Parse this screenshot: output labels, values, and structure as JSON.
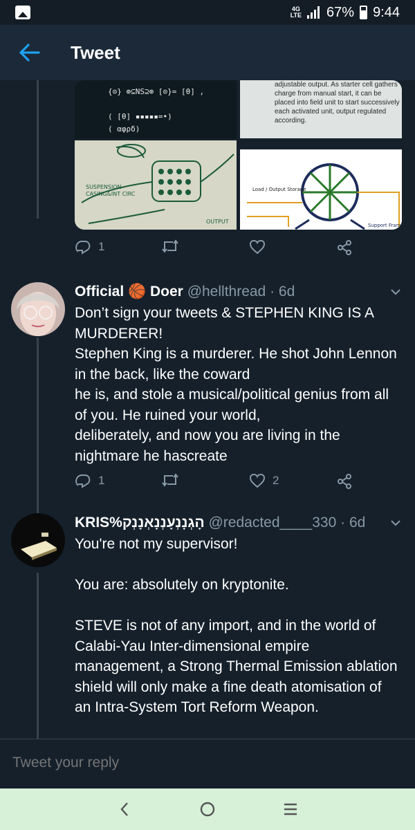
{
  "status_bar": {
    "network": "4G",
    "network_sub": "LTE",
    "battery": "67%",
    "time": "9:44"
  },
  "header": {
    "title": "Tweet",
    "back_icon": "arrow-left-icon"
  },
  "media": {
    "top_left_glyphs": "{⊙} ⊚⊆NS⊇⊚ [⊙}= [θ] ,\n\n( [θ] ▪▪▪▪▪=•)\n( αφρδ)\n( ↡ )",
    "top_right_caption": "adjustable output. As starter cell gathers charge from manual start, it can be placed into field unit to start successively each activated unit, output regulated according."
  },
  "first_actions": {
    "reply_count": "1",
    "retweet_count": "",
    "like_count": ""
  },
  "tweets": [
    {
      "name": "Official 🏀 Doer",
      "handle": "@hellthread",
      "time": "· 6d",
      "body": "Don’t sign your tweets & STEPHEN KING IS A MURDERER!\nStephen King is a murderer. He shot John Lennon in the back, like the coward\nhe is, and stole a musical/political genius from all of you. He ruined your world,\ndeliberately, and now you are living in the nightmare he hascreate",
      "reply_count": "1",
      "retweet_count": "",
      "like_count": "2"
    },
    {
      "name": "KRIS%הָגְנָנְעָנְנָאְנָנְק",
      "handle": "@redacted____330",
      "time": "· 6d",
      "body": "You're not my supervisor!\n\nYou are: absolutely on kryptonite.\n\nSTEVE is not of any import, and in the world of Calabi-Yau Inter-dimensional empire management, a Strong Thermal Emission ablation shield will only make a fine death atomisation of an Intra-System Tort Reform Weapon."
    }
  ],
  "reply": {
    "placeholder": "Tweet your reply"
  },
  "colors": {
    "background": "#15202b",
    "header": "#1c2938",
    "accent": "#1da1f2",
    "secondary_text": "#8899a6",
    "nav_bar": "#d7f0d8"
  }
}
